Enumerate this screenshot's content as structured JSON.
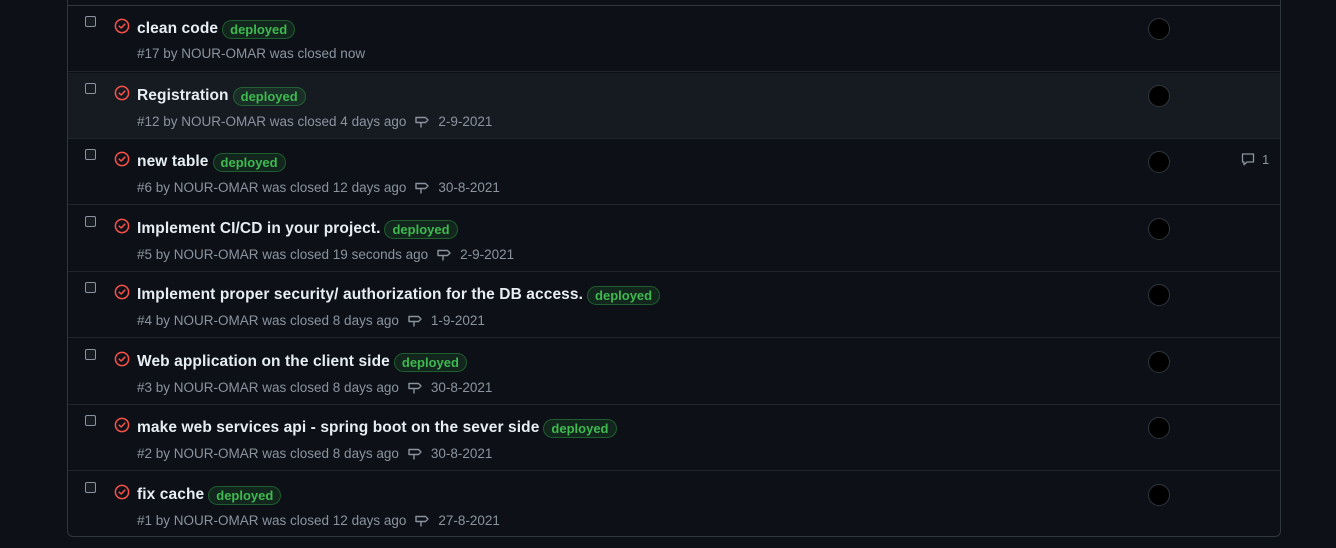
{
  "colors": {
    "closed_icon": "#f85149",
    "label_text": "#3fb950",
    "background": "#0d1117"
  },
  "issues": [
    {
      "title": "clean code",
      "label": "deployed",
      "meta": "#17 by NOUR-OMAR was closed now",
      "milestone": "",
      "comments": ""
    },
    {
      "title": "Registration",
      "label": "deployed",
      "meta": "#12 by NOUR-OMAR was closed 4 days ago",
      "milestone": "2-9-2021",
      "comments": ""
    },
    {
      "title": "new table",
      "label": "deployed",
      "meta": "#6 by NOUR-OMAR was closed 12 days ago",
      "milestone": "30-8-2021",
      "comments": "1"
    },
    {
      "title": "Implement CI/CD in your project.",
      "label": "deployed",
      "meta": "#5 by NOUR-OMAR was closed 19 seconds ago",
      "milestone": "2-9-2021",
      "comments": ""
    },
    {
      "title": "Implement proper security/ authorization for the DB access.",
      "label": "deployed",
      "meta": "#4 by NOUR-OMAR was closed 8 days ago",
      "milestone": "1-9-2021",
      "comments": ""
    },
    {
      "title": "Web application on the client side",
      "label": "deployed",
      "meta": "#3 by NOUR-OMAR was closed 8 days ago",
      "milestone": "30-8-2021",
      "comments": ""
    },
    {
      "title": "make web services api - spring boot on the sever side",
      "label": "deployed",
      "meta": "#2 by NOUR-OMAR was closed 8 days ago",
      "milestone": "30-8-2021",
      "comments": ""
    },
    {
      "title": "fix cache",
      "label": "deployed",
      "meta": "#1 by NOUR-OMAR was closed 12 days ago",
      "milestone": "27-8-2021",
      "comments": ""
    }
  ]
}
